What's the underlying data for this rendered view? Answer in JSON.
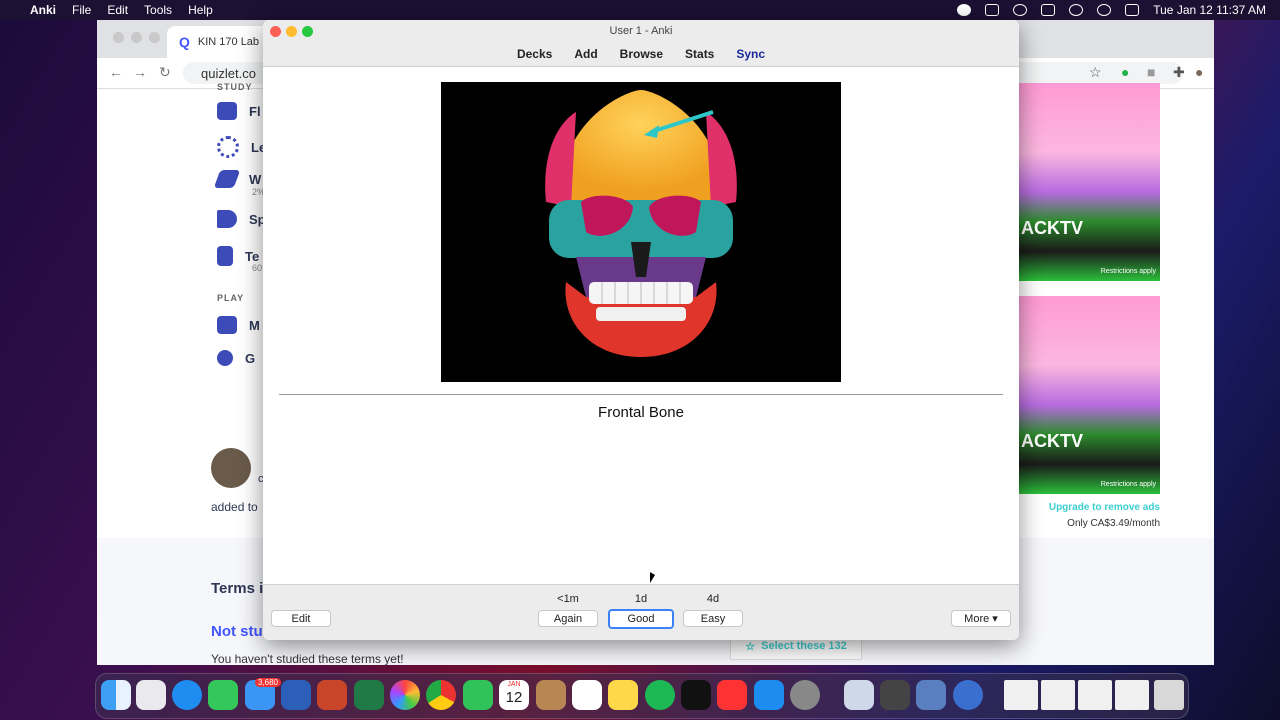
{
  "menubar": {
    "app": "Anki",
    "items": [
      "File",
      "Edit",
      "Tools",
      "Help"
    ],
    "clock": "Tue Jan 12  11:37 AM"
  },
  "browser": {
    "tab_title": "KIN 170 Lab M",
    "url": "quizlet.co"
  },
  "quizlet": {
    "study_header": "STUDY",
    "study_items": [
      {
        "label": "Fl",
        "sub": ""
      },
      {
        "label": "Le",
        "sub": ""
      },
      {
        "label": "W",
        "sub": "2%"
      },
      {
        "label": "Sp",
        "sub": ""
      },
      {
        "label": "Te",
        "sub": "60"
      }
    ],
    "play_header": "PLAY",
    "play_items": [
      {
        "label": "M"
      },
      {
        "label": "G"
      }
    ],
    "user_initial": "c",
    "added_to": "added to",
    "terms_heading": "Terms i",
    "not_studied": "Not stu",
    "havent_studied": "You haven't studied these terms yet!",
    "select_button": "Select these 132",
    "ad_text": "ACKTV",
    "ad_sub": "Restrictions apply",
    "upgrade": "Upgrade to remove ads",
    "price": "Only CA$3.49/month"
  },
  "anki": {
    "window_title": "User 1 - Anki",
    "nav": [
      "Decks",
      "Add",
      "Browse",
      "Stats",
      "Sync"
    ],
    "answer": "Frontal Bone",
    "edit_button": "Edit",
    "more_button": "More ▾",
    "intervals": [
      "<1m",
      "1d",
      "4d"
    ],
    "buttons": [
      "Again",
      "Good",
      "Easy"
    ]
  },
  "dock": {
    "mail_badge": "3,680",
    "calendar_month": "JAN",
    "calendar_day": "12"
  }
}
